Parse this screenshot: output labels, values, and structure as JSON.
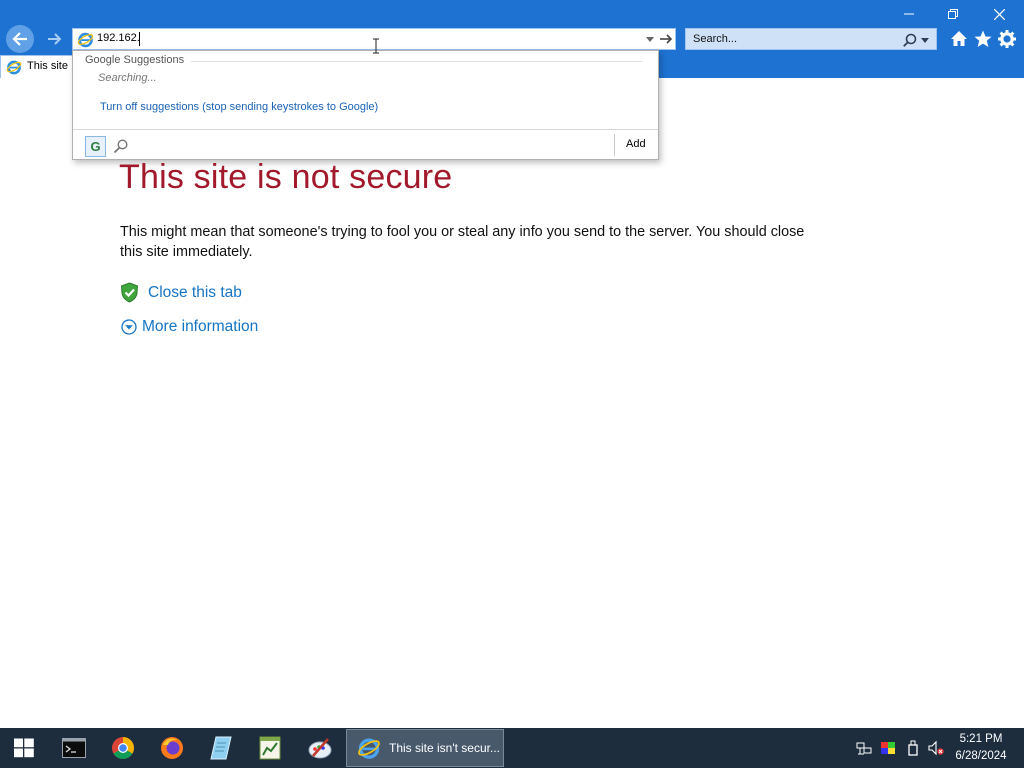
{
  "browser": {
    "address_value": "192.162.",
    "search_placeholder": "Search...",
    "tab_title": "This site",
    "window_controls": [
      "minimize",
      "restore",
      "close"
    ]
  },
  "suggestions": {
    "header": "Google Suggestions",
    "status": "Searching...",
    "turn_off_link": "Turn off suggestions (stop sending keystrokes to Google)",
    "provider_label": "G",
    "add_label": "Add"
  },
  "page": {
    "heading": "This site is not secure",
    "body": "This might mean that someone's trying to fool you or steal any info you send to the server. You should close this site immediately.",
    "close_link": "Close this tab",
    "more_link": "More information"
  },
  "taskbar": {
    "active_window_label": "This site isn't secur...",
    "time": "5:21 PM",
    "date": "6/28/2024",
    "pinned_icons": [
      "windows-start-icon",
      "terminal-icon",
      "chrome-icon",
      "firefox-icon",
      "notepad-icon",
      "chart-app-icon",
      "paint-icon",
      "internet-explorer-icon"
    ]
  },
  "colors": {
    "chrome_blue": "#1e72d2",
    "heading_red": "#a2192b",
    "link_blue": "#1574c4",
    "taskbar": "#1d2d3e"
  }
}
